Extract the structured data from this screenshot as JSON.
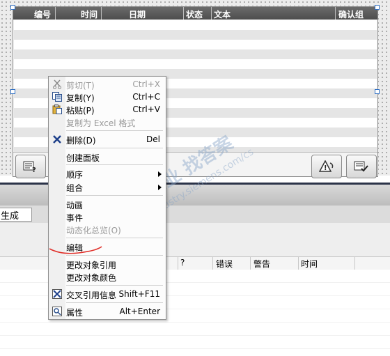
{
  "alarm_view": {
    "columns": [
      "编号",
      "时间",
      "日期",
      "状态",
      "文本",
      "确认组"
    ]
  },
  "properties": {
    "tab_label": "生成",
    "grid_columns": [
      "?",
      "错误",
      "警告",
      "时间"
    ]
  },
  "context_menu": {
    "items": [
      {
        "label": "剪切(T)",
        "shortcut": "Ctrl+X",
        "enabled": false,
        "icon": "scissors-icon"
      },
      {
        "label": "复制(Y)",
        "shortcut": "Ctrl+C",
        "enabled": true,
        "icon": "copy-icon"
      },
      {
        "label": "粘贴(P)",
        "shortcut": "Ctrl+V",
        "enabled": true,
        "icon": "paste-icon"
      },
      {
        "label": "复制为 Excel 格式",
        "shortcut": "",
        "enabled": false,
        "icon": ""
      },
      {
        "label": "删除(D)",
        "shortcut": "Del",
        "enabled": true,
        "icon": "delete-x-icon"
      },
      {
        "label": "创建面板",
        "shortcut": "",
        "enabled": true,
        "icon": ""
      },
      {
        "label": "顺序",
        "shortcut": "",
        "enabled": true,
        "icon": "",
        "submenu": true
      },
      {
        "label": "组合",
        "shortcut": "",
        "enabled": true,
        "icon": "",
        "submenu": true
      },
      {
        "label": "动画",
        "shortcut": "",
        "enabled": true,
        "icon": ""
      },
      {
        "label": "事件",
        "shortcut": "",
        "enabled": true,
        "icon": ""
      },
      {
        "label": "动态化总览(O)",
        "shortcut": "",
        "enabled": false,
        "icon": ""
      },
      {
        "label": "编辑",
        "shortcut": "",
        "enabled": true,
        "icon": ""
      },
      {
        "label": "更改对象引用",
        "shortcut": "",
        "enabled": true,
        "icon": ""
      },
      {
        "label": "更改对象颜色",
        "shortcut": "",
        "enabled": true,
        "icon": ""
      },
      {
        "label": "交叉引用信息",
        "shortcut": "Shift+F11",
        "enabled": true,
        "icon": "cross-reference-icon"
      },
      {
        "label": "属性",
        "shortcut": "Alt+Enter",
        "enabled": true,
        "icon": "properties-icon"
      }
    ]
  },
  "watermark": {
    "cn": "西门子工业 找答案",
    "url": "support.industry.siemens.com/cs"
  },
  "colors": {
    "header_bg": "#555555",
    "annotation_red": "#e0302a",
    "handle_blue": "#2f6fc4"
  }
}
